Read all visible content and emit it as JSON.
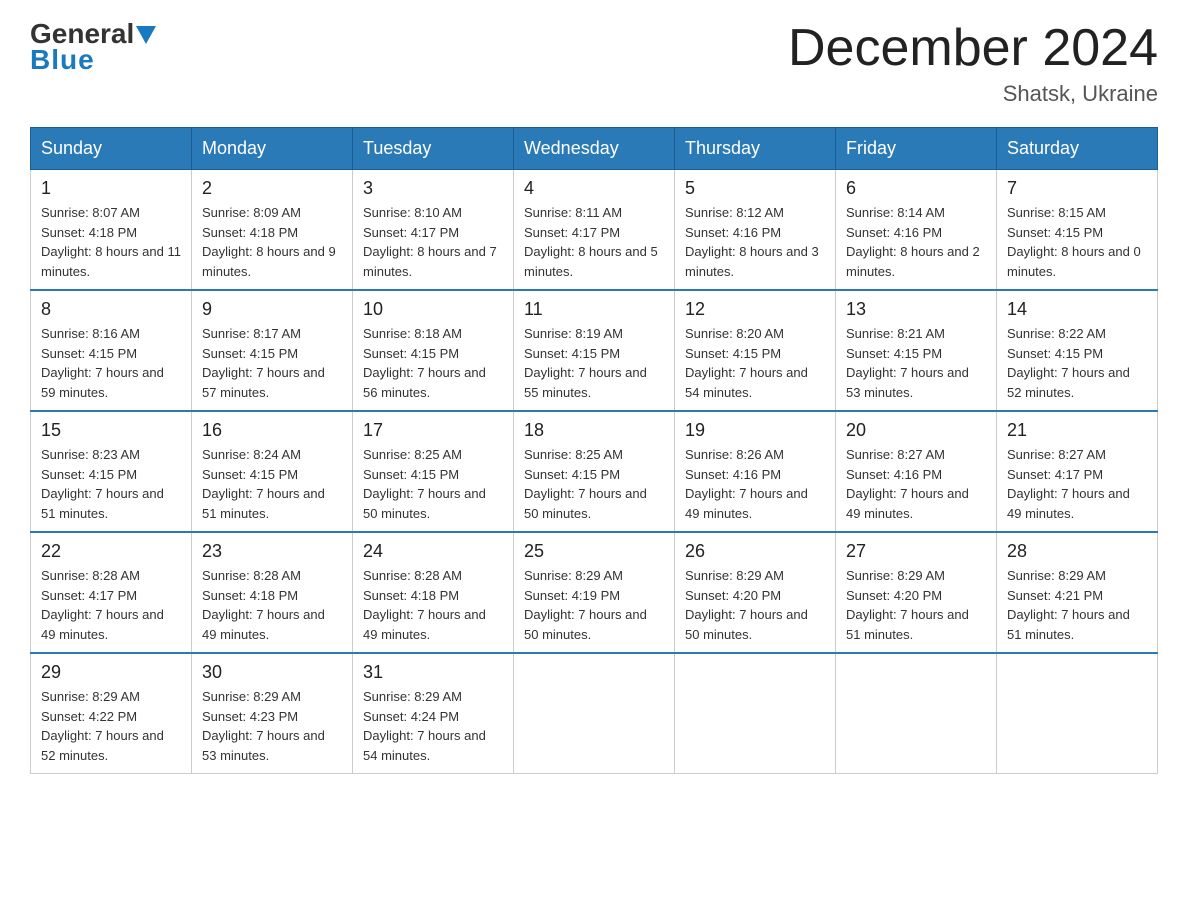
{
  "header": {
    "logo_general": "General",
    "logo_blue": "Blue",
    "month_title": "December 2024",
    "location": "Shatsk, Ukraine"
  },
  "weekdays": [
    "Sunday",
    "Monday",
    "Tuesday",
    "Wednesday",
    "Thursday",
    "Friday",
    "Saturday"
  ],
  "weeks": [
    [
      {
        "day": "1",
        "sunrise": "8:07 AM",
        "sunset": "4:18 PM",
        "daylight": "8 hours and 11 minutes."
      },
      {
        "day": "2",
        "sunrise": "8:09 AM",
        "sunset": "4:18 PM",
        "daylight": "8 hours and 9 minutes."
      },
      {
        "day": "3",
        "sunrise": "8:10 AM",
        "sunset": "4:17 PM",
        "daylight": "8 hours and 7 minutes."
      },
      {
        "day": "4",
        "sunrise": "8:11 AM",
        "sunset": "4:17 PM",
        "daylight": "8 hours and 5 minutes."
      },
      {
        "day": "5",
        "sunrise": "8:12 AM",
        "sunset": "4:16 PM",
        "daylight": "8 hours and 3 minutes."
      },
      {
        "day": "6",
        "sunrise": "8:14 AM",
        "sunset": "4:16 PM",
        "daylight": "8 hours and 2 minutes."
      },
      {
        "day": "7",
        "sunrise": "8:15 AM",
        "sunset": "4:15 PM",
        "daylight": "8 hours and 0 minutes."
      }
    ],
    [
      {
        "day": "8",
        "sunrise": "8:16 AM",
        "sunset": "4:15 PM",
        "daylight": "7 hours and 59 minutes."
      },
      {
        "day": "9",
        "sunrise": "8:17 AM",
        "sunset": "4:15 PM",
        "daylight": "7 hours and 57 minutes."
      },
      {
        "day": "10",
        "sunrise": "8:18 AM",
        "sunset": "4:15 PM",
        "daylight": "7 hours and 56 minutes."
      },
      {
        "day": "11",
        "sunrise": "8:19 AM",
        "sunset": "4:15 PM",
        "daylight": "7 hours and 55 minutes."
      },
      {
        "day": "12",
        "sunrise": "8:20 AM",
        "sunset": "4:15 PM",
        "daylight": "7 hours and 54 minutes."
      },
      {
        "day": "13",
        "sunrise": "8:21 AM",
        "sunset": "4:15 PM",
        "daylight": "7 hours and 53 minutes."
      },
      {
        "day": "14",
        "sunrise": "8:22 AM",
        "sunset": "4:15 PM",
        "daylight": "7 hours and 52 minutes."
      }
    ],
    [
      {
        "day": "15",
        "sunrise": "8:23 AM",
        "sunset": "4:15 PM",
        "daylight": "7 hours and 51 minutes."
      },
      {
        "day": "16",
        "sunrise": "8:24 AM",
        "sunset": "4:15 PM",
        "daylight": "7 hours and 51 minutes."
      },
      {
        "day": "17",
        "sunrise": "8:25 AM",
        "sunset": "4:15 PM",
        "daylight": "7 hours and 50 minutes."
      },
      {
        "day": "18",
        "sunrise": "8:25 AM",
        "sunset": "4:15 PM",
        "daylight": "7 hours and 50 minutes."
      },
      {
        "day": "19",
        "sunrise": "8:26 AM",
        "sunset": "4:16 PM",
        "daylight": "7 hours and 49 minutes."
      },
      {
        "day": "20",
        "sunrise": "8:27 AM",
        "sunset": "4:16 PM",
        "daylight": "7 hours and 49 minutes."
      },
      {
        "day": "21",
        "sunrise": "8:27 AM",
        "sunset": "4:17 PM",
        "daylight": "7 hours and 49 minutes."
      }
    ],
    [
      {
        "day": "22",
        "sunrise": "8:28 AM",
        "sunset": "4:17 PM",
        "daylight": "7 hours and 49 minutes."
      },
      {
        "day": "23",
        "sunrise": "8:28 AM",
        "sunset": "4:18 PM",
        "daylight": "7 hours and 49 minutes."
      },
      {
        "day": "24",
        "sunrise": "8:28 AM",
        "sunset": "4:18 PM",
        "daylight": "7 hours and 49 minutes."
      },
      {
        "day": "25",
        "sunrise": "8:29 AM",
        "sunset": "4:19 PM",
        "daylight": "7 hours and 50 minutes."
      },
      {
        "day": "26",
        "sunrise": "8:29 AM",
        "sunset": "4:20 PM",
        "daylight": "7 hours and 50 minutes."
      },
      {
        "day": "27",
        "sunrise": "8:29 AM",
        "sunset": "4:20 PM",
        "daylight": "7 hours and 51 minutes."
      },
      {
        "day": "28",
        "sunrise": "8:29 AM",
        "sunset": "4:21 PM",
        "daylight": "7 hours and 51 minutes."
      }
    ],
    [
      {
        "day": "29",
        "sunrise": "8:29 AM",
        "sunset": "4:22 PM",
        "daylight": "7 hours and 52 minutes."
      },
      {
        "day": "30",
        "sunrise": "8:29 AM",
        "sunset": "4:23 PM",
        "daylight": "7 hours and 53 minutes."
      },
      {
        "day": "31",
        "sunrise": "8:29 AM",
        "sunset": "4:24 PM",
        "daylight": "7 hours and 54 minutes."
      },
      null,
      null,
      null,
      null
    ]
  ],
  "labels": {
    "sunrise": "Sunrise:",
    "sunset": "Sunset:",
    "daylight": "Daylight:"
  }
}
